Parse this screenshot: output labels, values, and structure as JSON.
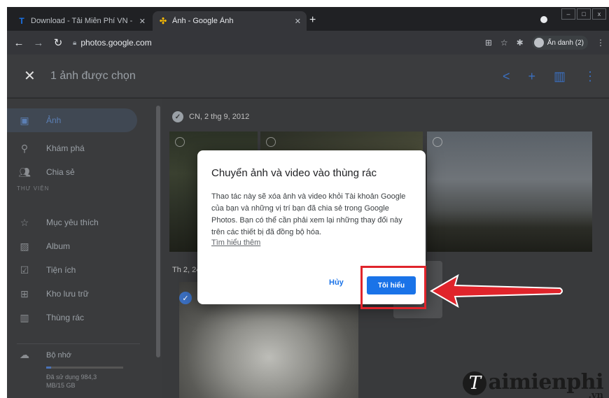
{
  "browser": {
    "tabs": [
      {
        "label": "Download - Tải Miễn Phí VN - Ph",
        "favicon": "T"
      },
      {
        "label": "Ảnh - Google Ảnh",
        "favicon": "✣"
      }
    ],
    "newtab": "+",
    "url": "photos.google.com",
    "profile": "Ẩn danh (2)",
    "window_controls": [
      "–",
      "□",
      "x"
    ]
  },
  "header": {
    "selection_text": "1 ảnh được chọn",
    "icons": [
      "share-icon",
      "add-icon",
      "trash-icon",
      "more-icon"
    ]
  },
  "sidebar": {
    "items": [
      {
        "label": "Ảnh",
        "icon": "photo-icon"
      },
      {
        "label": "Khám phá",
        "icon": "search-icon"
      },
      {
        "label": "Chia sẻ",
        "icon": "people-icon"
      }
    ],
    "section_label": "THƯ VIỆN",
    "library": [
      {
        "label": "Mục yêu thích",
        "icon": "star-icon"
      },
      {
        "label": "Album",
        "icon": "album-icon"
      },
      {
        "label": "Tiện ích",
        "icon": "utilities-icon"
      },
      {
        "label": "Kho lưu trữ",
        "icon": "archive-icon"
      },
      {
        "label": "Thùng rác",
        "icon": "trash-icon"
      }
    ],
    "storage": {
      "label": "Bộ nhớ",
      "used_text": "Đã sử dụng 984,3 MB/15 GB",
      "used_fraction": 0.064
    }
  },
  "main": {
    "group1_date": "CN, 2 thg 9, 2012",
    "group2_date": "Th 2, 24"
  },
  "dialog": {
    "title": "Chuyển ảnh và video vào thùng rác",
    "body": "Thao tác này sẽ xóa ảnh và video khỏi Tài khoản Google của bạn và những vị trí bạn đã chia sẻ trong Google Photos. Bạn có thể cần phải xem lại những thay đổi này trên các thiết bị đã đồng bộ hóa.",
    "link": "Tìm hiểu thêm",
    "cancel_label": "Hủy",
    "confirm_label": "Tôi hiểu"
  },
  "watermark": {
    "logo_letter": "T",
    "text": "aimienphi",
    "suffix": ".vn"
  },
  "colors": {
    "accent": "#1a73e8",
    "highlight": "#e0242b"
  }
}
